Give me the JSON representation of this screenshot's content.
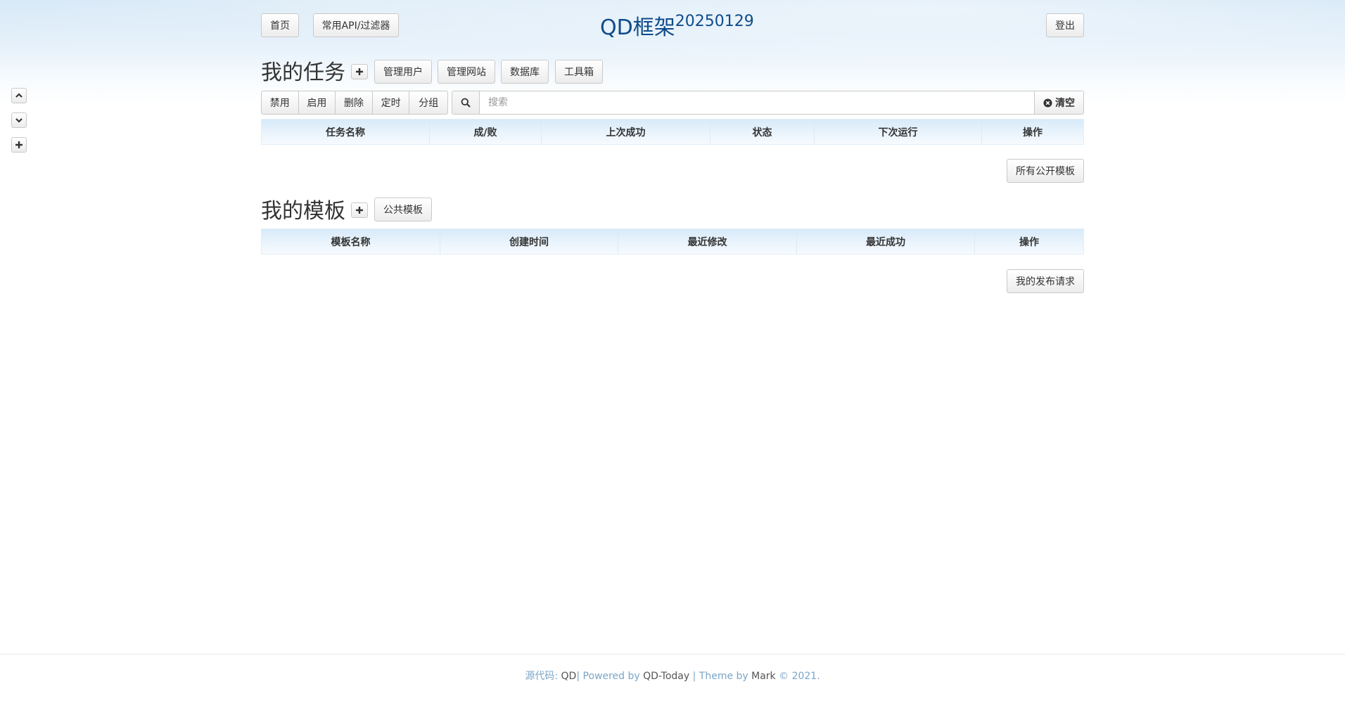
{
  "nav": {
    "home": "首页",
    "api_filter": "常用API/过滤器",
    "logout": "登出"
  },
  "title": {
    "main": "QD框架",
    "version": "20250129"
  },
  "tasks": {
    "heading": "我的任务",
    "toolbar": [
      "管理用户",
      "管理网站",
      "数据库",
      "工具箱"
    ],
    "actions": [
      "禁用",
      "启用",
      "删除",
      "定时",
      "分组"
    ],
    "search": {
      "placeholder": "搜索",
      "clear": "清空"
    },
    "columns": [
      "任务名称",
      "成/败",
      "上次成功",
      "状态",
      "下次运行",
      "操作"
    ],
    "all_public_templates": "所有公开模板"
  },
  "templates": {
    "heading": "我的模板",
    "public_templates": "公共模板",
    "columns": [
      "模板名称",
      "创建时间",
      "最近修改",
      "最近成功",
      "操作"
    ],
    "my_publish_requests": "我的发布请求"
  },
  "footer": {
    "source_label": "源代码:",
    "source_name": "QD",
    "powered_label": "| Powered by",
    "powered_name": "QD-Today",
    "theme_label": "| Theme by",
    "theme_name": "Mark",
    "copyright": "© 2021."
  },
  "icons": {
    "scroll_up": "chevron-up-icon",
    "scroll_down": "chevron-down-icon",
    "add": "plus-icon",
    "search": "search-icon",
    "clear": "close-circle-icon"
  },
  "colors": {
    "title": "#0f4c8a",
    "footer_link": "#7aa6c8",
    "table_header": "#d7eaf9"
  }
}
